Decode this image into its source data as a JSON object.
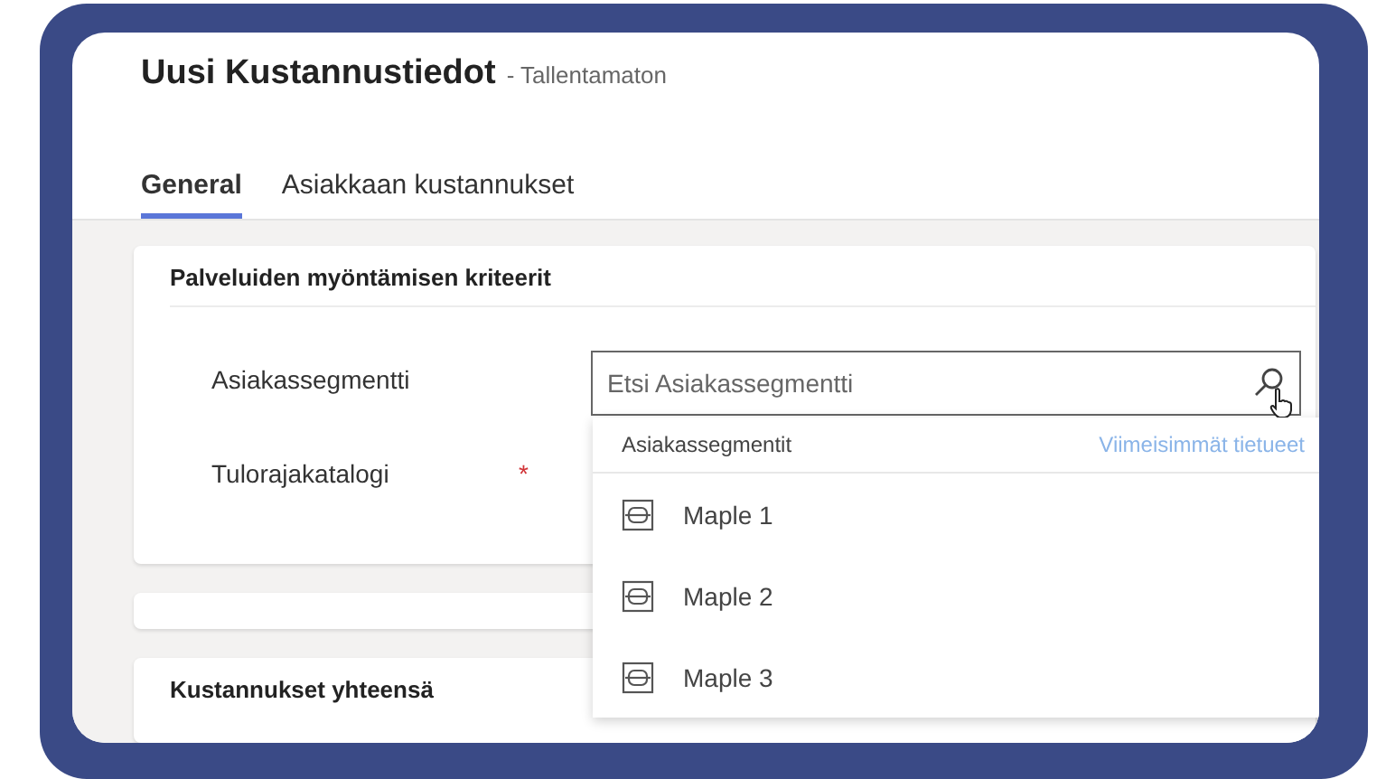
{
  "form": {
    "title": "Uusi Kustannustiedot",
    "status": "- Tallentamaton"
  },
  "tabs": [
    {
      "label": "General",
      "selected": true
    },
    {
      "label": "Asiakkaan kustannukset",
      "selected": false
    }
  ],
  "sections": [
    {
      "kind": "form",
      "title": "Palveluiden myöntämisen kriteerit",
      "fields": [
        {
          "label": "Asiakassegmentti",
          "kind": "lookup",
          "placeholder": "Etsi Asiakassegmentti"
        },
        {
          "label": "Tulorajakatalogi",
          "required_marker": "*",
          "kind": "plain"
        }
      ]
    },
    {
      "kind": "blank"
    },
    {
      "kind": "form",
      "title": "Kustannukset yhteensä"
    }
  ],
  "lookup_dropdown": {
    "header": "Asiakassegmentit",
    "link": "Viimeisimmät tietueet",
    "items": [
      {
        "label": "Maple 1"
      },
      {
        "label": "Maple 2"
      },
      {
        "label": "Maple 3"
      }
    ]
  }
}
